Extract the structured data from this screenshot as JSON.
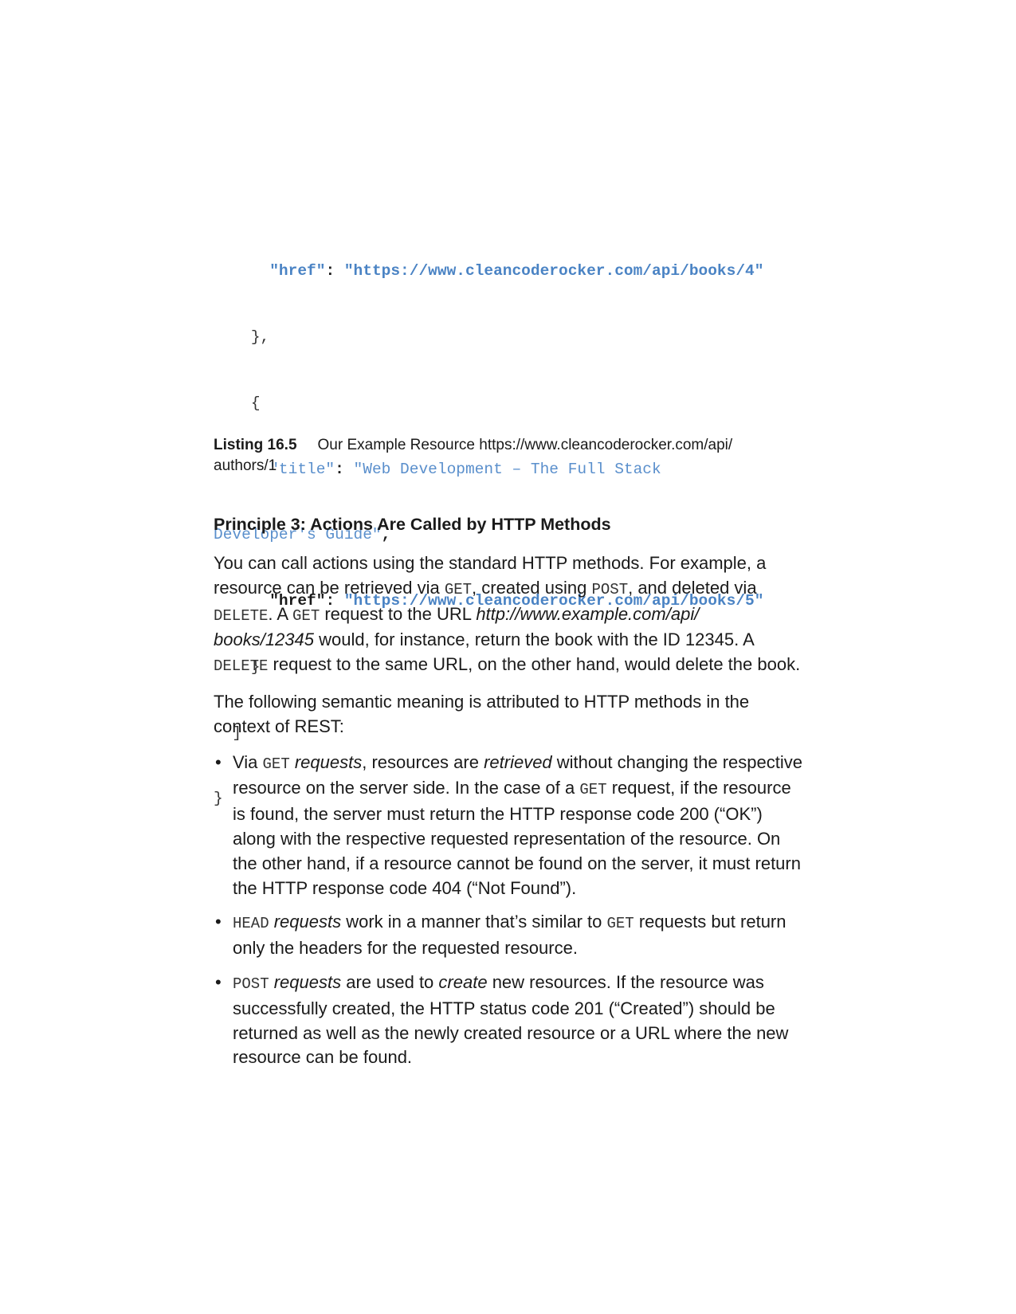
{
  "code_listing": {
    "l1_key": "\"href\"",
    "l1_sep": ": ",
    "l1_val": "\"https://www.cleancoderocker.com/api/books/4\"",
    "l2": "},",
    "l3": "{",
    "l4_key": "\"title\"",
    "l4_sep": ": ",
    "l4_val": "\"Web Development – The Full Stack",
    "l5_val": "Developer's Guide\"",
    "l5_comma": ",",
    "l6_key": "\"href\"",
    "l6_sep": ": ",
    "l6_val": "\"https://www.cleancoderocker.com/api/books/5\"",
    "l7": "}",
    "l8": "]",
    "l9": "}"
  },
  "caption": {
    "label": "Listing 16.5",
    "text": "Our Example Resource https://www.cleancoderocker.com/api/",
    "text2": "authors/1"
  },
  "section": {
    "heading": "Principle 3: Actions Are Called by HTTP Methods"
  },
  "para1": {
    "t1": "You can call actions using the standard HTTP methods. For example, a resource can be retrieved via ",
    "c1": "GET",
    "t2": ", created using ",
    "c2": "POST",
    "t3": ", and deleted via ",
    "c3": "DELETE",
    "t4": ". A ",
    "c4": "GET",
    "t5": " request to the URL ",
    "i1": "http://www.example.com/api/ books/12345",
    "t6": " would, for instance, return the book with the ID 12345. A ",
    "c5": "DELETE",
    "t7": " request to the same URL, on the other hand, would delete the book."
  },
  "para2": {
    "text": "The following semantic meaning is attributed to HTTP methods in the context of REST:"
  },
  "bullets": {
    "symbol": "•",
    "b1": {
      "t1": "Via ",
      "c1": "GET",
      "i1": " requests",
      "t2": ", resources are ",
      "i2": "retrieved",
      "t3": " without changing the respective resource on the server side. In the case of a ",
      "c2": "GET",
      "t4": " request, if the resource is found, the server must return the HTTP response code 200 (“OK”) along with the respective requested representation of the resource. On the other hand, if a resource cannot be found on the server, it must return the HTTP response code 404 (“Not Found”)."
    },
    "b2": {
      "c1": "HEAD",
      "i1": " requests",
      "t1": " work in a manner that’s similar to ",
      "c2": "GET",
      "t2": " requests but return only the headers for the requested resource."
    },
    "b3": {
      "c1": "POST",
      "i1": " requests",
      "t1": " are used to ",
      "i2": "create",
      "t2": " new resources. If the resource was successfully created, the HTTP status code 201 (“Created”) should be returned as well as the newly created resource or a URL where the new resource can be found."
    }
  }
}
